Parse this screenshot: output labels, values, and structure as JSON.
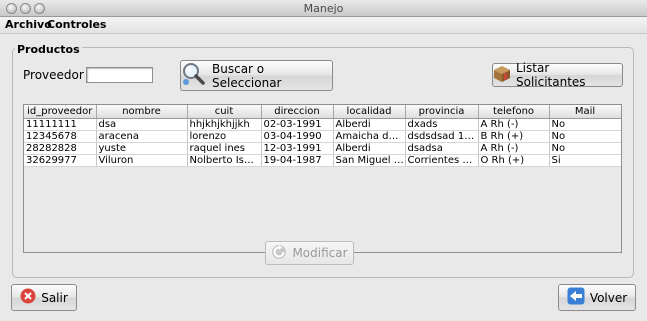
{
  "window": {
    "title": "Manejo"
  },
  "menu": {
    "items": [
      "Archivo",
      "Controles"
    ]
  },
  "group": {
    "title": "Productos"
  },
  "filter": {
    "label": "Proveedor",
    "value": "",
    "placeholder": ""
  },
  "buttons": {
    "buscar": "Buscar o Seleccionar",
    "solicitantes": "Listar Solicitantes",
    "modificar": "Modificar",
    "salir": "Salir",
    "volver": "Volver"
  },
  "table": {
    "columns": [
      "id_proveedor",
      "nombre",
      "cuit",
      "direccion",
      "localidad",
      "provincia",
      "telefono",
      "Mail"
    ],
    "rows": [
      [
        "11111111",
        "dsa",
        "hhjkhjkhjjkh",
        "02-03-1991",
        "Alberdi",
        "dxads",
        "A Rh (-)",
        "No"
      ],
      [
        "12345678",
        "aracena",
        "lorenzo",
        "03-04-1990",
        "Amaicha de Val...",
        "dsdsdsad 13...",
        "B Rh (+)",
        "No"
      ],
      [
        "28282828",
        "yuste",
        "raquel ines",
        "12-03-1991",
        "Alberdi",
        "dsadsa",
        "A Rh (-)",
        "No"
      ],
      [
        "32629977",
        "Viluron",
        "Nolberto Ismael",
        "19-04-1987",
        "San Miguel de ...",
        "Corrientes 165...",
        "O Rh (+)",
        "Si"
      ]
    ]
  },
  "icons": {
    "buscar": "magnifier-icon",
    "solicitantes": "package-icon",
    "modificar": "refresh-icon",
    "salir": "cancel-icon",
    "volver": "back-arrow-icon"
  },
  "colors": {
    "accent": "#3a7fd6",
    "cancel": "#d9443b"
  }
}
